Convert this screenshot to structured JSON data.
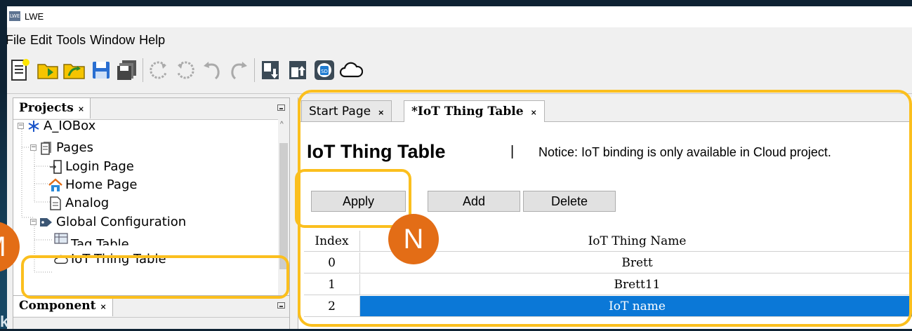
{
  "window": {
    "title": "LWE",
    "app_icon_text": "LWE"
  },
  "menu": [
    "File",
    "Edit",
    "Tools",
    "Window",
    "Help"
  ],
  "toolbar_icons": [
    "new-project-icon",
    "open-folder-icon",
    "open-project-icon",
    "save-icon",
    "save-all-icon",
    "rotate-ccw-icon",
    "rotate-cw-icon",
    "undo-icon",
    "redo-icon",
    "download-icon",
    "upload-icon",
    "sd-card-icon",
    "cloud-icon"
  ],
  "projects_panel": {
    "tab_label": "Projects",
    "close_symbol": "×",
    "tree": {
      "root": "A_IOBox",
      "pages": "Pages",
      "login_page": "Login Page",
      "home_page": "Home Page",
      "analog": "Analog",
      "global_config": "Global Configuration",
      "tag_table": "Tag Table",
      "iot_thing_table": "IoT Thing Table"
    }
  },
  "component_panel": {
    "tab_label": "Component",
    "close_symbol": "×"
  },
  "editor": {
    "tabs": [
      {
        "label": "Start Page",
        "close_symbol": "×"
      },
      {
        "label": "*IoT Thing Table",
        "close_symbol": "×"
      }
    ],
    "page_title": "IoT Thing Table",
    "separator": "|",
    "notice": "Notice: IoT binding is only available in Cloud project.",
    "buttons": {
      "apply": "Apply",
      "add": "Add",
      "delete": "Delete"
    },
    "table": {
      "headers": [
        "Index",
        "IoT Thing Name"
      ],
      "rows": [
        {
          "index": "0",
          "name": "Brett"
        },
        {
          "index": "1",
          "name": "Brett11"
        },
        {
          "index": "2",
          "name": "IoT name"
        }
      ],
      "selected_row": 2
    }
  },
  "annotations": {
    "m_label": "M",
    "n_label": "N"
  },
  "colors": {
    "highlight": "#fbbf1e",
    "badge": "#e36d16",
    "selection": "#0b78d7"
  }
}
